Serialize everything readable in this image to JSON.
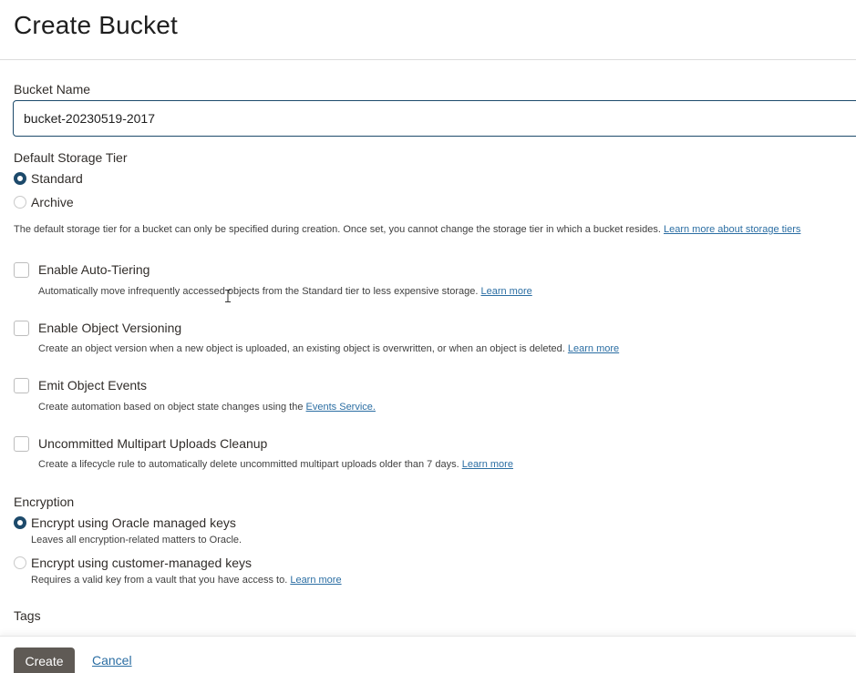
{
  "page": {
    "title": "Create Bucket"
  },
  "bucket_name": {
    "label": "Bucket Name",
    "value": "bucket-20230519-2017"
  },
  "storage_tier": {
    "label": "Default Storage Tier",
    "options": [
      {
        "label": "Standard",
        "selected": true
      },
      {
        "label": "Archive",
        "selected": false
      }
    ],
    "help": "The default storage tier for a bucket can only be specified during creation. Once set, you cannot change the storage tier in which a bucket resides.",
    "help_link": "Learn more about storage tiers"
  },
  "options": [
    {
      "label": "Enable Auto-Tiering",
      "checked": false,
      "help": "Automatically move infrequently accessed objects from the Standard tier to less expensive storage.",
      "link": "Learn more"
    },
    {
      "label": "Enable Object Versioning",
      "checked": false,
      "help": "Create an object version when a new object is uploaded, an existing object is overwritten, or when an object is deleted.",
      "link": "Learn more"
    },
    {
      "label": "Emit Object Events",
      "checked": false,
      "help": "Create automation based on object state changes using the",
      "link": "Events Service."
    },
    {
      "label": "Uncommitted Multipart Uploads Cleanup",
      "checked": false,
      "help": "Create a lifecycle rule to automatically delete uncommitted multipart uploads older than 7 days.",
      "link": "Learn more"
    }
  ],
  "encryption": {
    "label": "Encryption",
    "options": [
      {
        "label": "Encrypt using Oracle managed keys",
        "selected": true,
        "help": "Leaves all encryption-related matters to Oracle.",
        "link": ""
      },
      {
        "label": "Encrypt using customer-managed keys",
        "selected": false,
        "help": "Requires a valid key from a vault that you have access to.",
        "link": "Learn more"
      }
    ]
  },
  "tags": {
    "label": "Tags"
  },
  "footer": {
    "create_label": "Create",
    "cancel_label": "Cancel"
  }
}
